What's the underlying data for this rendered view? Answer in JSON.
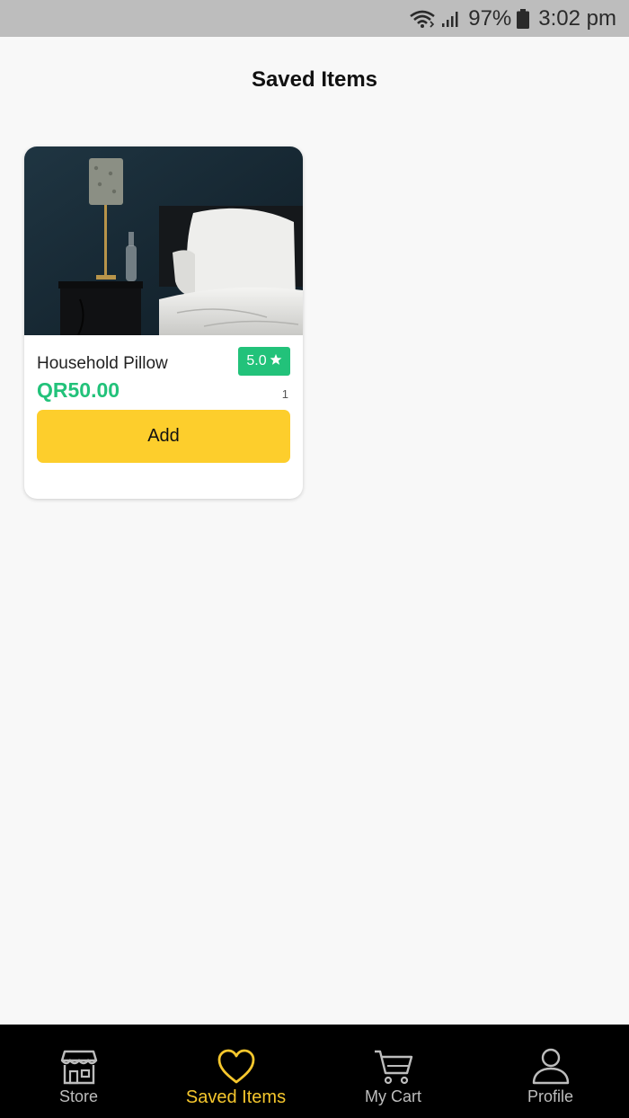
{
  "status_bar": {
    "battery": "97%",
    "time": "3:02 pm"
  },
  "header": {
    "title": "Saved Items"
  },
  "saved_items": [
    {
      "name": "Household Pillow",
      "rating": "5.0",
      "price": "QR50.00",
      "quantity": "1",
      "add_label": "Add"
    }
  ],
  "bottom_nav": {
    "items": [
      {
        "label": "Store",
        "icon": "store-icon",
        "active": false
      },
      {
        "label": "Saved Items",
        "icon": "heart-icon",
        "active": true
      },
      {
        "label": "My Cart",
        "icon": "cart-icon",
        "active": false
      },
      {
        "label": "Profile",
        "icon": "profile-icon",
        "active": false
      }
    ]
  },
  "colors": {
    "accent_green": "#22c27a",
    "accent_yellow": "#fdce2c",
    "active_nav": "#f6c72d",
    "nav_background": "#000000",
    "status_bar": "#bdbdbd"
  }
}
